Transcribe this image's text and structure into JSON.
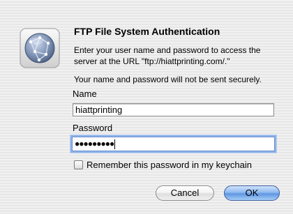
{
  "dialog": {
    "title": "FTP File System Authentication",
    "message": "Enter your user name and password to access the server at the URL \"ftp://hiattprinting.com/.\"",
    "security_note": "Your name and password will not be sent securely.",
    "icon": "network-globe-icon"
  },
  "form": {
    "name_label": "Name",
    "name_value": "hiattprinting",
    "password_label": "Password",
    "password_masked": "●●●●●●●●●",
    "remember_label": "Remember this password in my keychain",
    "remember_checked": false
  },
  "buttons": {
    "cancel_label": "Cancel",
    "ok_label": "OK"
  },
  "colors": {
    "default_button": "#6aa0e8",
    "focus_ring": "#8fb3e8"
  }
}
